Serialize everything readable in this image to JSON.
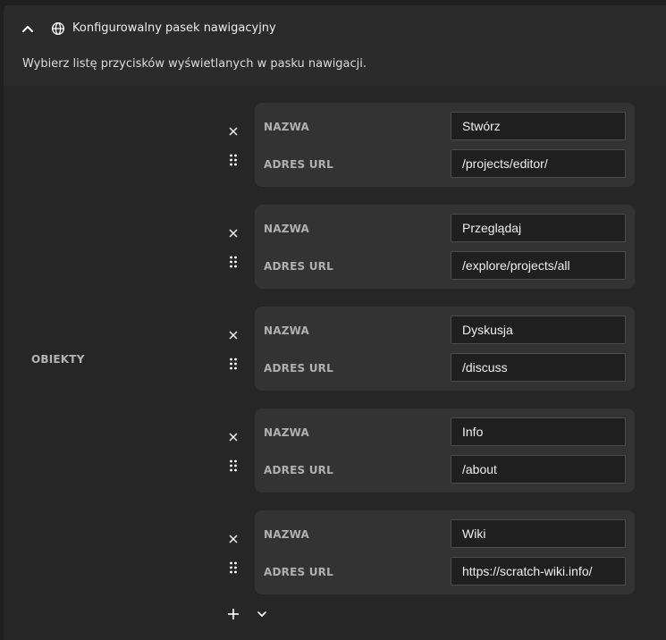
{
  "section": {
    "title": "Konfigurowalny pasek nawigacyjny",
    "description": "Wybierz listę przycisków wyświetlanych w pasku nawigacji.",
    "collapse_icon": "chevron-up-icon",
    "section_icon": "globe-icon"
  },
  "list": {
    "label": "OBIEKTY",
    "name_label": "NAZWA",
    "url_label": "ADRES URL",
    "items": [
      {
        "name": "Stwórz",
        "url": "/projects/editor/"
      },
      {
        "name": "Przeglądaj",
        "url": "/explore/projects/all"
      },
      {
        "name": "Dyskusja",
        "url": "/discuss"
      },
      {
        "name": "Info",
        "url": "/about"
      },
      {
        "name": "Wiki",
        "url": "https://scratch-wiki.info/"
      }
    ]
  },
  "icons": {
    "remove": "close-icon",
    "drag": "drag-handle-icon",
    "add": "plus-icon",
    "dropdown": "chevron-down-icon"
  },
  "colors": {
    "background": "#1f1f1f",
    "panel": "#2b2b2b",
    "card": "#333333",
    "input": "#1f1f1f"
  }
}
